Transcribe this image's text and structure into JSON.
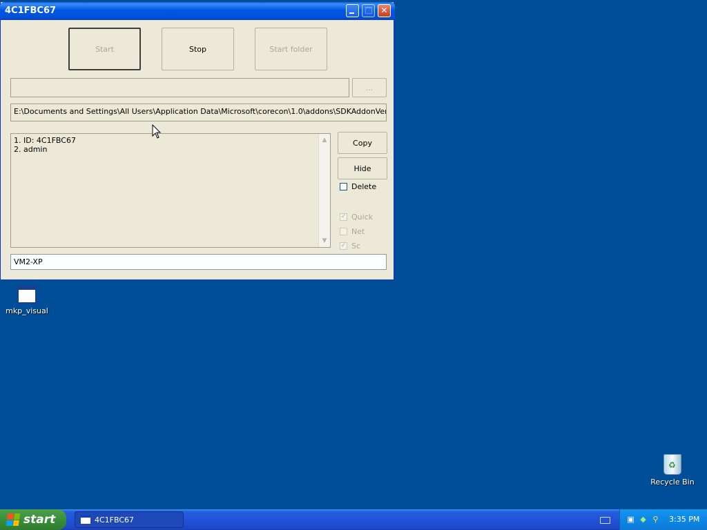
{
  "window": {
    "title": "4C1FBC67",
    "buttons": {
      "start": "Start",
      "stop": "Stop",
      "start_folder": "Start folder",
      "browse": "...",
      "copy": "Copy",
      "hide": "Hide"
    },
    "path_input": "",
    "file_path": "E:\\Documents and Settings\\All Users\\Application Data\\Microsoft\\corecon\\1.0\\addons\\SDKAddonVer.dll",
    "list_lines": [
      "1. ID: 4C1FBC67",
      "2. admin"
    ],
    "checkboxes": {
      "delete": {
        "label": "Delete",
        "checked": false
      },
      "quick": {
        "label": "Quick",
        "checked": true
      },
      "net": {
        "label": "Net",
        "checked": false
      },
      "sc": {
        "label": "Sc",
        "checked": true
      }
    },
    "computer_name": "VM2-XP"
  },
  "desktop": {
    "icons": [
      {
        "label": "mkp_visual",
        "icon": "window-app-icon"
      },
      {
        "label": "Recycle Bin",
        "icon": "recycle-bin-icon"
      }
    ]
  },
  "taskbar": {
    "start_label": "start",
    "task_label": "4C1FBC67",
    "clock": "3:35 PM"
  }
}
